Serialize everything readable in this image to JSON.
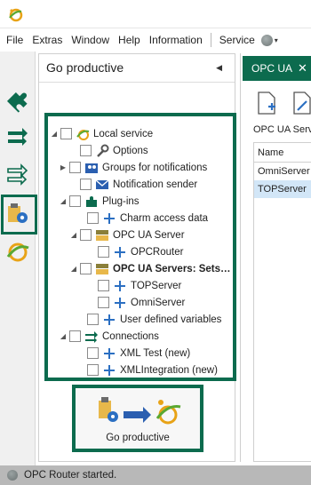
{
  "window": {
    "logo_icon": "opc-router-logo"
  },
  "menu": {
    "items": [
      "File",
      "Extras",
      "Window",
      "Help",
      "Information"
    ],
    "service": "Service",
    "status_icon": "gray-status-dot"
  },
  "sidebar": {
    "icons": [
      "puzzle-icon",
      "arrows-icon",
      "arrows-outline-icon",
      "service-gear-icon",
      "connection-ring-icon"
    ],
    "highlight_color": "#0c6b4e"
  },
  "panel": {
    "title": "Go productive",
    "tree": [
      {
        "label": "Local service",
        "icon": "local-service-icon",
        "expander": "expanded"
      },
      {
        "label": "Options",
        "icon": "wrench-icon",
        "expander": ""
      },
      {
        "label": "Groups for notifications",
        "icon": "users-icon",
        "expander": "collapsed"
      },
      {
        "label": "Notification sender",
        "icon": "mail-icon",
        "expander": ""
      },
      {
        "label": "Plug-ins",
        "icon": "puzzle-icon",
        "expander": "expanded"
      },
      {
        "label": "Charm access data",
        "icon": "plus-icon",
        "expander": ""
      },
      {
        "label": "OPC UA Server",
        "icon": "opc-server-icon",
        "expander": "expanded"
      },
      {
        "label": "OPCRouter",
        "icon": "plus-icon",
        "expander": ""
      },
      {
        "label": "OPC UA Servers: Sets…",
        "icon": "opc-server-icon",
        "expander": "expanded",
        "bold": true
      },
      {
        "label": "TOPServer",
        "icon": "plus-icon",
        "expander": ""
      },
      {
        "label": "OmniServer",
        "icon": "plus-icon",
        "expander": ""
      },
      {
        "label": "User defined variables",
        "icon": "plus-icon",
        "expander": ""
      },
      {
        "label": "Connections",
        "icon": "arrows-icon",
        "expander": "expanded"
      },
      {
        "label": "XML Test (new)",
        "icon": "plus-icon",
        "expander": ""
      },
      {
        "label": "XMLIntegration (new)",
        "icon": "plus-icon",
        "expander": ""
      }
    ],
    "go_productive_button": "Go productive"
  },
  "right_panel": {
    "tab_label": "OPC UA",
    "section_label": "OPC UA Serve",
    "grid_header": "Name",
    "rows": [
      "OmniServer",
      "TOPServer"
    ],
    "selected_row": "TOPServer"
  },
  "status": {
    "text": "OPC Router started."
  },
  "colors": {
    "accent": "#0c6b4e",
    "selection": "#d2e6f7",
    "statusbar": "#b8b8b8"
  }
}
